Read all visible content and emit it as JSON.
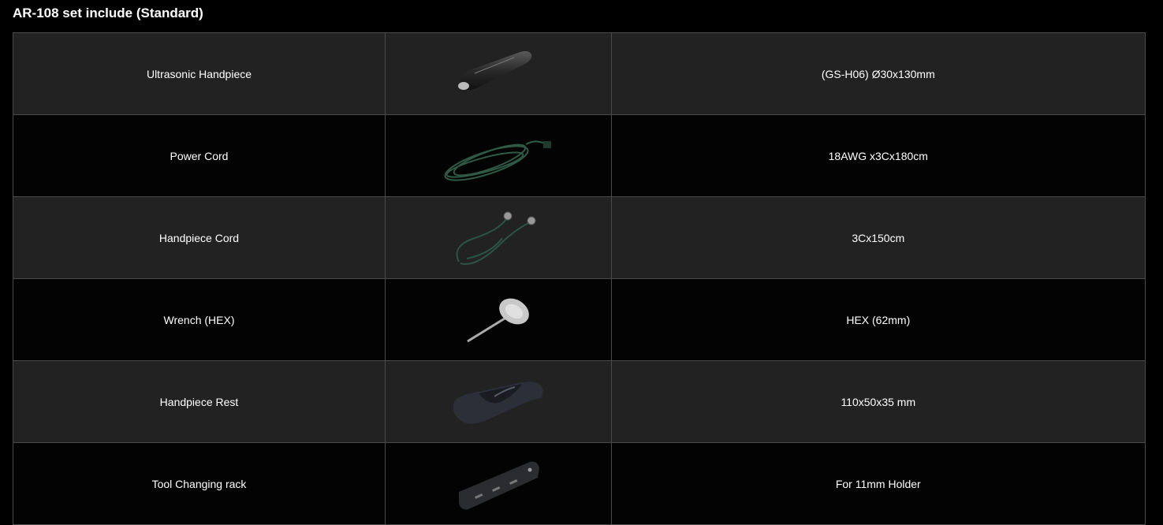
{
  "title": "AR-108 set include (Standard)",
  "items": [
    {
      "name": "Ultrasonic Handpiece",
      "spec": "(GS-H06) Ø30x130mm",
      "icon": "ultrasonic-handpiece-icon"
    },
    {
      "name": "Power Cord",
      "spec": "18AWG x3Cx180cm",
      "icon": "power-cord-icon"
    },
    {
      "name": "Handpiece Cord",
      "spec": "3Cx150cm",
      "icon": "handpiece-cord-icon"
    },
    {
      "name": "Wrench (HEX)",
      "spec": "HEX (62mm)",
      "icon": "hex-wrench-icon"
    },
    {
      "name": "Handpiece Rest",
      "spec": "110x50x35 mm",
      "icon": "handpiece-rest-icon"
    },
    {
      "name": "Tool Changing rack",
      "spec": "For 11mm Holder",
      "icon": "tool-changing-rack-icon"
    }
  ]
}
